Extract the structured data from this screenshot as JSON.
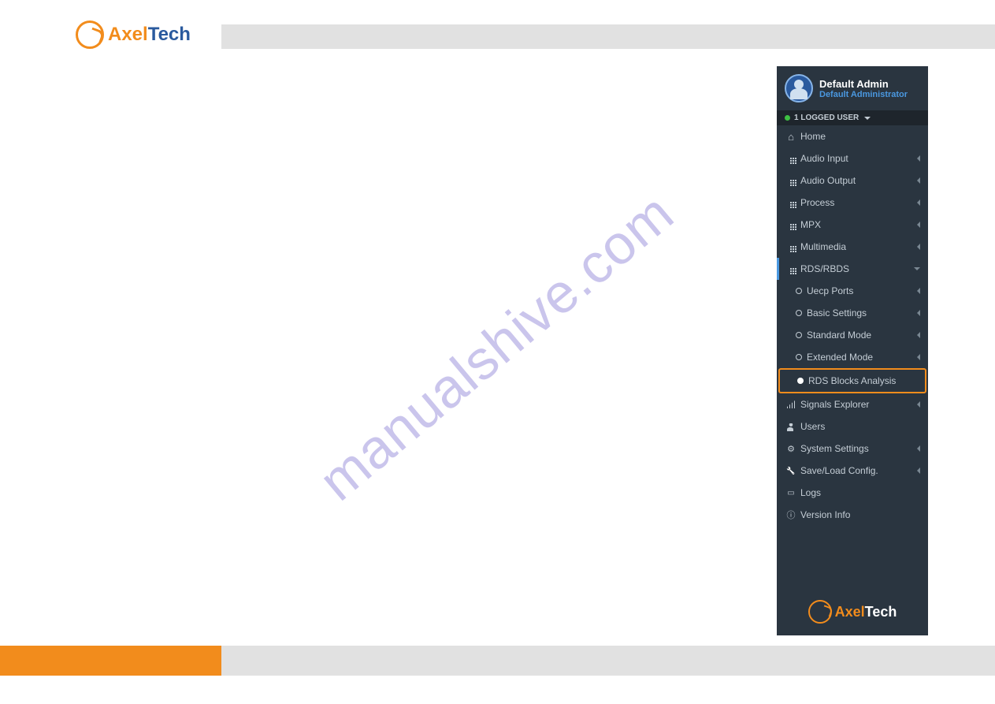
{
  "brand": {
    "part1": "Axel",
    "part2": "Tech"
  },
  "watermark": "manualshive.com",
  "user": {
    "name": "Default Admin",
    "role": "Default Administrator"
  },
  "loggedUsers": "1 LOGGED USER",
  "nav": {
    "home": "Home",
    "audioInput": "Audio Input",
    "audioOutput": "Audio Output",
    "process": "Process",
    "mpx": "MPX",
    "multimedia": "Multimedia",
    "rdsRbds": "RDS/RBDS",
    "uecpPorts": "Uecp Ports",
    "basicSettings": "Basic Settings",
    "standardMode": "Standard Mode",
    "extendedMode": "Extended Mode",
    "rdsBlocks": "RDS Blocks Analysis",
    "signalsExplorer": "Signals Explorer",
    "users": "Users",
    "systemSettings": "System Settings",
    "saveLoad": "Save/Load Config.",
    "logs": "Logs",
    "versionInfo": "Version Info"
  }
}
